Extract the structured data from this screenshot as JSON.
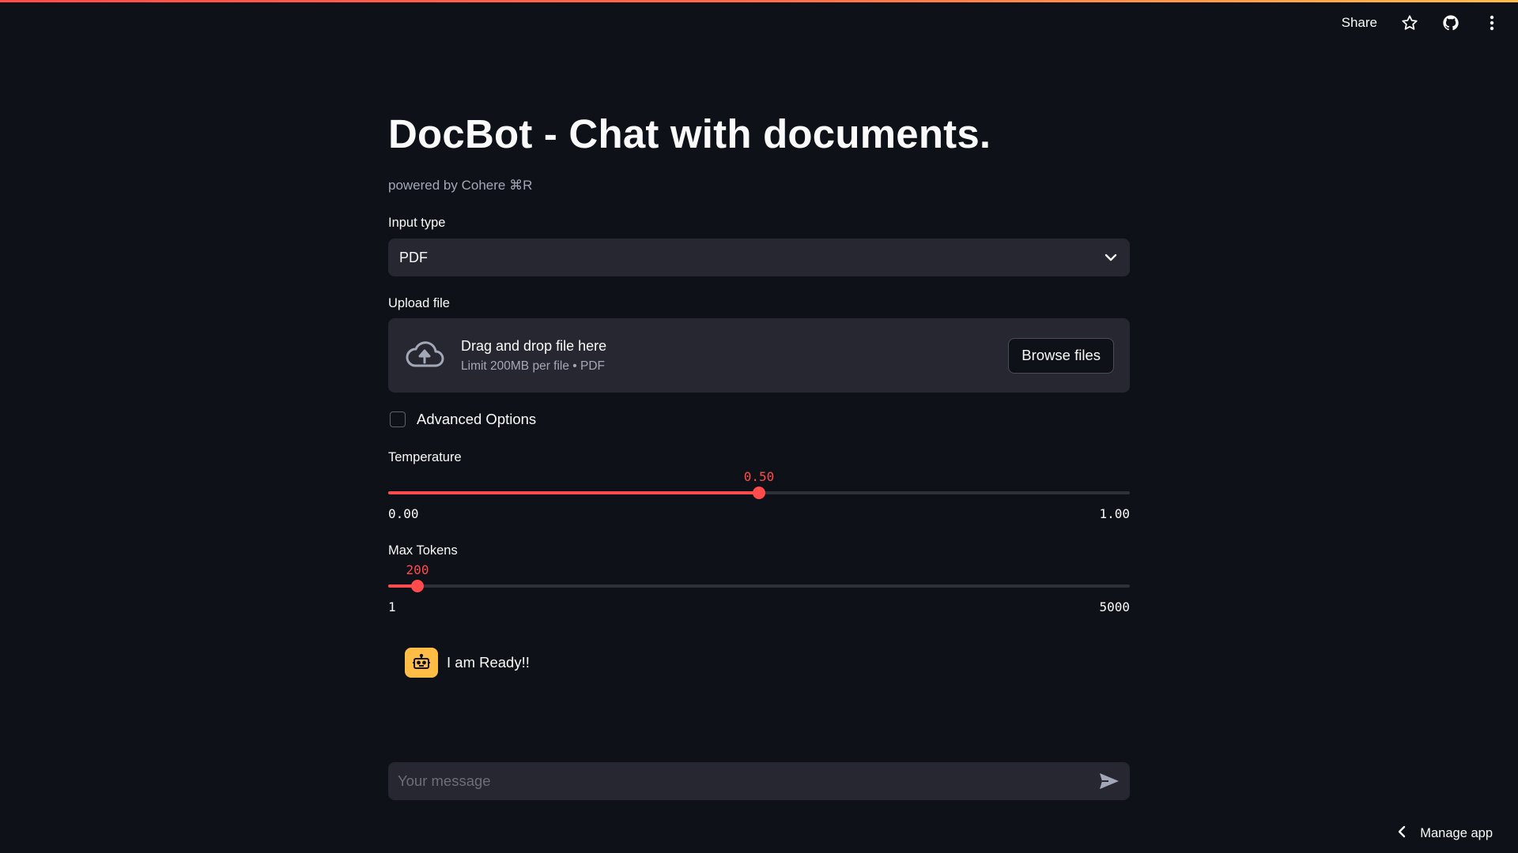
{
  "toolbar": {
    "share_label": "Share",
    "icons": [
      "star-icon",
      "github-icon",
      "more-vertical-icon"
    ]
  },
  "header": {
    "title": "DocBot - Chat with documents.",
    "caption": "powered by Cohere ⌘R"
  },
  "input_type": {
    "label": "Input type",
    "selected": "PDF"
  },
  "upload": {
    "label": "Upload file",
    "drop_text": "Drag and drop file here",
    "limit_text": "Limit 200MB per file • PDF",
    "browse_label": "Browse files"
  },
  "advanced": {
    "label": "Advanced Options",
    "checked": false
  },
  "temperature": {
    "label": "Temperature",
    "value": "0.50",
    "min": "0.00",
    "max": "1.00",
    "fraction": 0.5
  },
  "max_tokens": {
    "label": "Max Tokens",
    "value": "200",
    "min": "1",
    "max": "5000",
    "fraction": 0.0398
  },
  "chat": {
    "assistant_message": "I am Ready!!",
    "input_placeholder": "Your message"
  },
  "footer": {
    "manage_label": "Manage app"
  },
  "colors": {
    "accent": "#ff4b4b",
    "background": "#0e1117",
    "widget_bg": "#262730",
    "avatar": "#ffbd45"
  }
}
